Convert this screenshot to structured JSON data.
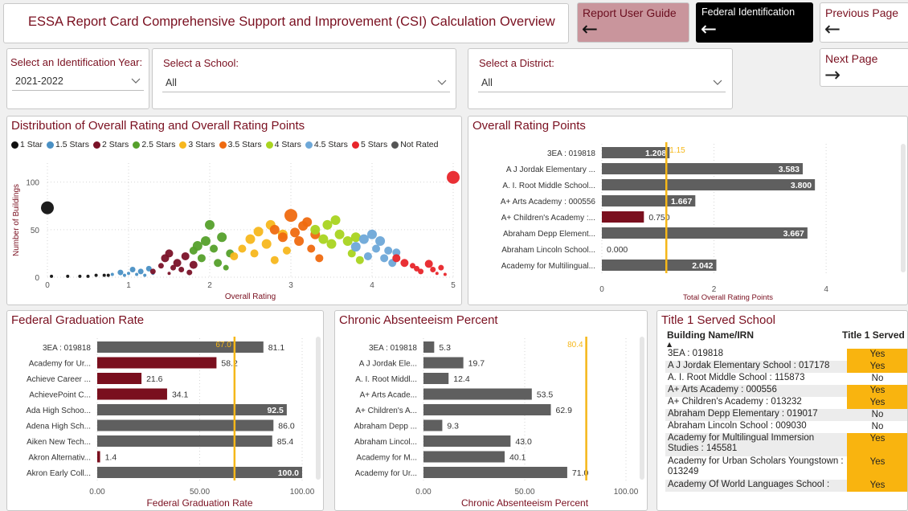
{
  "header": {
    "title": "ESSA Report Card Comprehensive Support and Improvement (CSI) Calculation Overview"
  },
  "nav": {
    "guide": {
      "label": "Report User Guide",
      "icon": "arrow-left-icon"
    },
    "federal": {
      "label": "Federal Identification",
      "icon": "arrow-left-icon"
    },
    "prev": {
      "label": "Previous Page",
      "icon": "arrow-left-icon"
    },
    "next": {
      "label": "Next Page",
      "icon": "arrow-right-icon"
    }
  },
  "slicers": {
    "year": {
      "label": "Select an Identification Year:",
      "value": "2021-2022"
    },
    "school": {
      "label": "Select a School:",
      "value": "All"
    },
    "district": {
      "label": "Select a District:",
      "value": "All"
    }
  },
  "colors": {
    "accent": "#7a1020",
    "bar": "#5f5f5f",
    "highlight": "#f5b719",
    "yes": "#f9b40f"
  },
  "distribution": {
    "title": "Distribution of Overall Rating and Overall Rating Points",
    "legend": [
      {
        "label": "1 Star",
        "color": "#111111"
      },
      {
        "label": "1.5 Stars",
        "color": "#4a90c4"
      },
      {
        "label": "2 Stars",
        "color": "#7a1228"
      },
      {
        "label": "2.5 Stars",
        "color": "#55a02b"
      },
      {
        "label": "3 Stars",
        "color": "#f7b71d"
      },
      {
        "label": "3.5 Stars",
        "color": "#ef6a10"
      },
      {
        "label": "4 Stars",
        "color": "#a9d420"
      },
      {
        "label": "4.5 Stars",
        "color": "#6ea8d8"
      },
      {
        "label": "5 Stars",
        "color": "#e8252a"
      },
      {
        "label": "Not Rated",
        "color": "#555555"
      }
    ],
    "ylabel": "Number of Buildings",
    "xlabel": "Overall Rating"
  },
  "ratingPoints": {
    "title": "Overall Rating Points",
    "xlabel": "Total Overall Rating Points",
    "refLabel": "1.15"
  },
  "gradRate": {
    "title": "Federal Graduation Rate",
    "xlabel": "Federal Graduation Rate",
    "refLabel": "67.0"
  },
  "absent": {
    "title": "Chronic Absenteeism Percent",
    "xlabel": "Chronic Absenteeism Percent",
    "refLabel": "80.4"
  },
  "title1": {
    "title": "Title 1 Served School",
    "col1": "Building Name/IRN",
    "col2": "Title 1 Served",
    "rows": [
      {
        "name": "3EA : 019818",
        "value": "Yes"
      },
      {
        "name": "A J Jordak Elementary School : 017178",
        "value": "Yes"
      },
      {
        "name": "A. I. Root Middle School : 115873",
        "value": "No"
      },
      {
        "name": "A+ Arts Academy : 000556",
        "value": "Yes"
      },
      {
        "name": "A+ Children's Academy : 013232",
        "value": "Yes"
      },
      {
        "name": "Abraham Depp Elementary : 019017",
        "value": "No"
      },
      {
        "name": "Abraham Lincoln School : 009030",
        "value": "No"
      },
      {
        "name": "Academy for Multilingual Immersion Studies : 145581",
        "value": "Yes"
      },
      {
        "name": "Academy for Urban Scholars Youngstown : 013249",
        "value": "Yes"
      },
      {
        "name": "Academy Of World Languages School :",
        "value": "Yes"
      }
    ]
  },
  "chart_data": [
    {
      "type": "scatter",
      "title": "Distribution of Overall Rating and Overall Rating Points",
      "xlabel": "Overall Rating",
      "ylabel": "Number of Buildings",
      "xlim": [
        0,
        5
      ],
      "ylim": [
        0,
        120
      ],
      "xticks": [
        "0",
        "1",
        "2",
        "3",
        "4",
        "5"
      ],
      "yticks": [
        "0",
        "50",
        "100"
      ],
      "series": [
        {
          "name": "1 Star",
          "points": [
            [
              0.0,
              73
            ],
            [
              0.05,
              1
            ],
            [
              0.25,
              1
            ],
            [
              0.4,
              1
            ],
            [
              0.5,
              1
            ],
            [
              0.6,
              2
            ],
            [
              0.7,
              2
            ],
            [
              0.75,
              2
            ]
          ]
        },
        {
          "name": "1.5 Stars",
          "points": [
            [
              0.8,
              3
            ],
            [
              0.9,
              5
            ],
            [
              1.0,
              4
            ],
            [
              1.05,
              8
            ],
            [
              1.1,
              3
            ],
            [
              1.15,
              6
            ],
            [
              1.2,
              2
            ],
            [
              1.25,
              9
            ],
            [
              1.3,
              4
            ],
            [
              0.95,
              2
            ]
          ]
        },
        {
          "name": "2 Stars",
          "points": [
            [
              1.3,
              6
            ],
            [
              1.4,
              12
            ],
            [
              1.45,
              20
            ],
            [
              1.5,
              25
            ],
            [
              1.55,
              10
            ],
            [
              1.6,
              15
            ],
            [
              1.65,
              8
            ],
            [
              1.7,
              22
            ],
            [
              1.75,
              5
            ],
            [
              1.8,
              13
            ],
            [
              1.5,
              4
            ]
          ]
        },
        {
          "name": "2.5 Stars",
          "points": [
            [
              1.8,
              28
            ],
            [
              1.85,
              33
            ],
            [
              1.9,
              20
            ],
            [
              1.95,
              38
            ],
            [
              2.0,
              55
            ],
            [
              2.05,
              30
            ],
            [
              2.1,
              15
            ],
            [
              2.15,
              42
            ],
            [
              2.2,
              10
            ],
            [
              2.25,
              25
            ]
          ]
        },
        {
          "name": "3 Stars",
          "points": [
            [
              2.3,
              22
            ],
            [
              2.4,
              30
            ],
            [
              2.5,
              40
            ],
            [
              2.55,
              25
            ],
            [
              2.6,
              48
            ],
            [
              2.7,
              35
            ],
            [
              2.75,
              55
            ],
            [
              2.8,
              18
            ],
            [
              2.9,
              45
            ],
            [
              2.95,
              28
            ]
          ]
        },
        {
          "name": "3.5 Stars",
          "points": [
            [
              2.8,
              50
            ],
            [
              2.9,
              42
            ],
            [
              3.0,
              65
            ],
            [
              3.05,
              47
            ],
            [
              3.1,
              38
            ],
            [
              3.15,
              54
            ],
            [
              3.2,
              58
            ],
            [
              3.25,
              30
            ],
            [
              3.3,
              45
            ],
            [
              3.35,
              20
            ]
          ]
        },
        {
          "name": "4 Stars",
          "points": [
            [
              3.3,
              50
            ],
            [
              3.4,
              40
            ],
            [
              3.45,
              55
            ],
            [
              3.5,
              35
            ],
            [
              3.55,
              60
            ],
            [
              3.6,
              45
            ],
            [
              3.7,
              38
            ],
            [
              3.75,
              25
            ],
            [
              3.8,
              42
            ],
            [
              3.85,
              18
            ]
          ]
        },
        {
          "name": "4.5 Stars",
          "points": [
            [
              3.8,
              32
            ],
            [
              3.9,
              40
            ],
            [
              3.95,
              22
            ],
            [
              4.0,
              45
            ],
            [
              4.05,
              30
            ],
            [
              4.1,
              38
            ],
            [
              4.15,
              20
            ],
            [
              4.2,
              28
            ],
            [
              4.25,
              15
            ],
            [
              4.3,
              26
            ]
          ]
        },
        {
          "name": "5 Stars",
          "points": [
            [
              4.3,
              20
            ],
            [
              4.4,
              15
            ],
            [
              4.5,
              12
            ],
            [
              4.55,
              9
            ],
            [
              4.6,
              6
            ],
            [
              4.7,
              14
            ],
            [
              4.75,
              8
            ],
            [
              4.8,
              4
            ],
            [
              4.85,
              10
            ],
            [
              4.9,
              3
            ],
            [
              5.0,
              105
            ]
          ]
        }
      ]
    },
    {
      "type": "bar",
      "orientation": "horizontal",
      "title": "Overall Rating Points",
      "xlabel": "Total Overall Rating Points",
      "categories": [
        "3EA : 019818",
        "A J Jordak Elementary ...",
        "A. I. Root Middle School...",
        "A+ Arts Academy : 000556",
        "A+ Children's Academy :...",
        "Abraham Depp Element...",
        "Abraham Lincoln School...",
        "Academy for Multilingual..."
      ],
      "values": [
        1.208,
        3.583,
        3.8,
        1.667,
        0.75,
        3.667,
        0.0,
        2.042
      ],
      "labels": [
        "1.208",
        "3.583",
        "3.800",
        "1.667",
        "0.750",
        "3.667",
        "0.000",
        "2.042"
      ],
      "highlight": [
        4
      ],
      "reference": 1.15,
      "xlim": [
        0,
        4.5
      ],
      "xticks": [
        "0",
        "2",
        "4"
      ]
    },
    {
      "type": "bar",
      "orientation": "horizontal",
      "title": "Federal Graduation Rate",
      "xlabel": "Federal Graduation Rate",
      "categories": [
        "3EA : 019818",
        "Academy for Ur...",
        "Achieve Career ...",
        "AchievePoint C...",
        "Ada High Schoo...",
        "Adena High Sch...",
        "Aiken New Tech...",
        "Akron Alternativ...",
        "Akron Early Coll..."
      ],
      "values": [
        81.1,
        58.2,
        21.6,
        34.1,
        92.5,
        86.0,
        85.4,
        1.4,
        100.0
      ],
      "labels": [
        "81.1",
        "58.2",
        "21.6",
        "34.1",
        "92.5",
        "86.0",
        "85.4",
        "1.4",
        "100.0"
      ],
      "highlight": [
        1,
        2,
        3,
        7
      ],
      "reference": 67.0,
      "xlim": [
        0,
        100
      ],
      "xticks": [
        "0.00",
        "50.00",
        "100.00"
      ]
    },
    {
      "type": "bar",
      "orientation": "horizontal",
      "title": "Chronic Absenteeism Percent",
      "xlabel": "Chronic Absenteeism Percent",
      "categories": [
        "3EA : 019818",
        "A J Jordak Ele...",
        "A. I. Root Middl...",
        "A+ Arts Acade...",
        "A+ Children's A...",
        "Abraham Depp ...",
        "Abraham Lincol...",
        "Academy for M...",
        "Academy for Ur..."
      ],
      "values": [
        5.3,
        19.7,
        12.4,
        53.5,
        62.9,
        9.3,
        43.0,
        40.1,
        71.0
      ],
      "labels": [
        "5.3",
        "19.7",
        "12.4",
        "53.5",
        "62.9",
        "9.3",
        "43.0",
        "40.1",
        "71.0"
      ],
      "highlight": [],
      "reference": 80.4,
      "xlim": [
        0,
        100
      ],
      "xticks": [
        "0.00",
        "50.00",
        "100.00"
      ]
    }
  ]
}
